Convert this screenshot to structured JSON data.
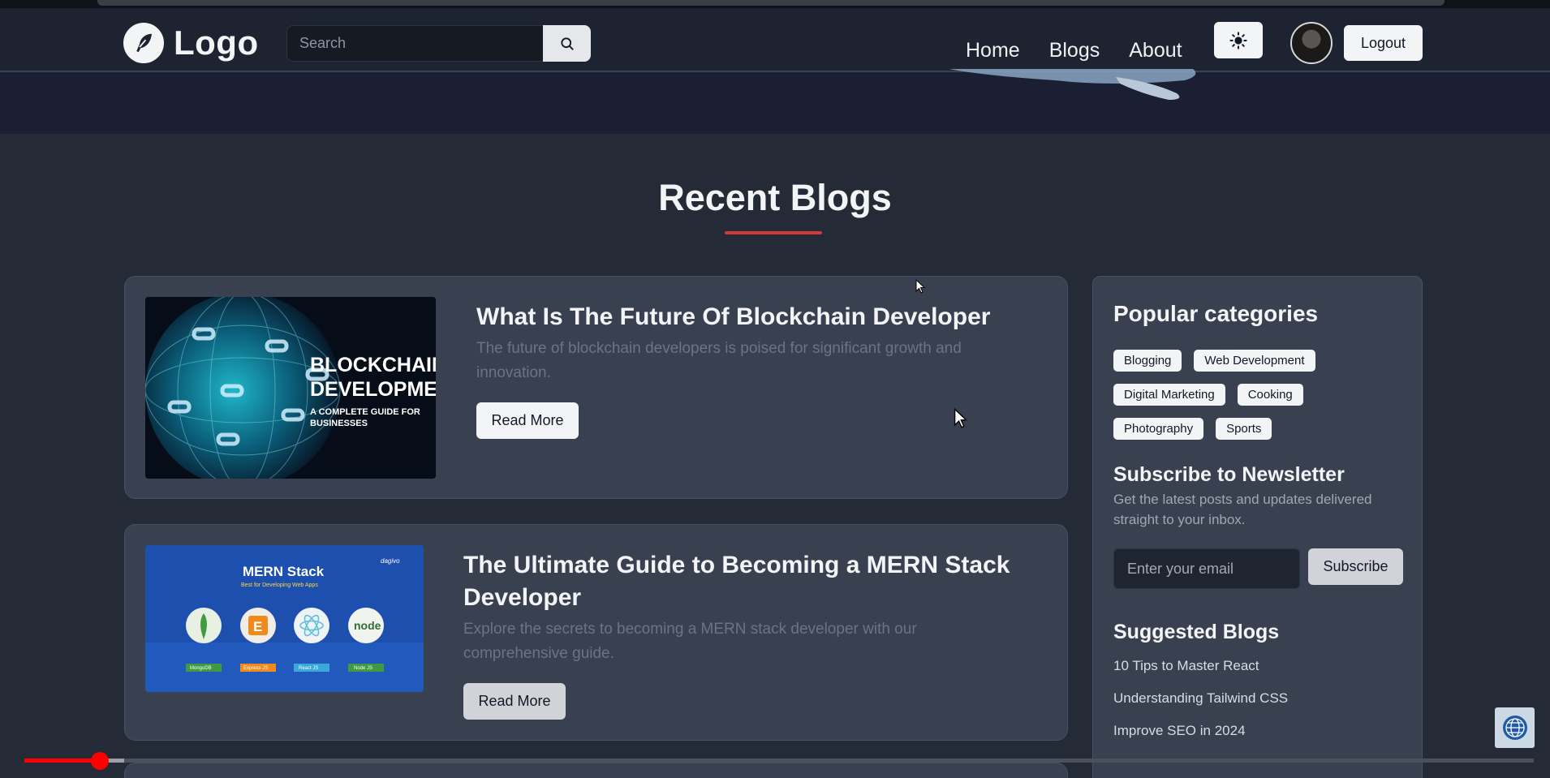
{
  "navbar": {
    "logo_text": "Logo",
    "search": {
      "placeholder": "Search"
    },
    "links": [
      {
        "label": "Home"
      },
      {
        "label": "Blogs"
      },
      {
        "label": "About"
      }
    ],
    "logout_label": "Logout"
  },
  "main": {
    "section_title": "Recent Blogs",
    "posts": [
      {
        "title": "What Is The Future Of Blockchain Developer",
        "excerpt": "The future of blockchain developers is poised for significant growth and innovation.",
        "read_more": "Read More",
        "thumbnail": {
          "line1": "BLOCKCHAIN",
          "line2": "DEVELOPMENT",
          "subtitle1": "A COMPLETE GUIDE FOR",
          "subtitle2": "BUSINESSES"
        }
      },
      {
        "title_line1": "The Ultimate Guide to Becoming a MERN Stack",
        "title_line2": "Developer",
        "excerpt": "Explore the secrets to becoming a MERN stack developer with our comprehensive guide.",
        "read_more": "Read More",
        "thumbnail": {
          "heading": "MERN Stack",
          "subheading": "Best for Developing Web Apps",
          "brand": "dagivo",
          "tech": [
            "MongoDB",
            "Express JS",
            "React JS",
            "Node JS"
          ],
          "node_logo_text": "node",
          "express_logo_text": "E"
        }
      }
    ]
  },
  "sidebar": {
    "categories_heading": "Popular categories",
    "categories": [
      [
        "Blogging",
        "Web Development"
      ],
      [
        "Digital Marketing",
        "Cooking"
      ],
      [
        "Photography",
        "Sports"
      ]
    ],
    "newsletter_heading": "Subscribe to Newsletter",
    "newsletter_text": "Get the latest posts and updates delivered straight to your inbox.",
    "email_placeholder": "Enter your email",
    "subscribe_label": "Subscribe",
    "suggested_heading": "Suggested Blogs",
    "suggested": [
      "10 Tips to Master React",
      "Understanding Tailwind CSS",
      "Improve SEO in 2024"
    ]
  },
  "video_player": {
    "progress_fraction": 0.05
  },
  "colors": {
    "accent_red": "#d23a3a",
    "navbar_bg": "#1d2330",
    "page_bg": "#252b36",
    "card_bg": "#394151",
    "progress_red": "#ff0000"
  },
  "icons": [
    "feather-icon",
    "search-icon",
    "sun-icon",
    "globe-badge-icon",
    "cursor-icon"
  ]
}
